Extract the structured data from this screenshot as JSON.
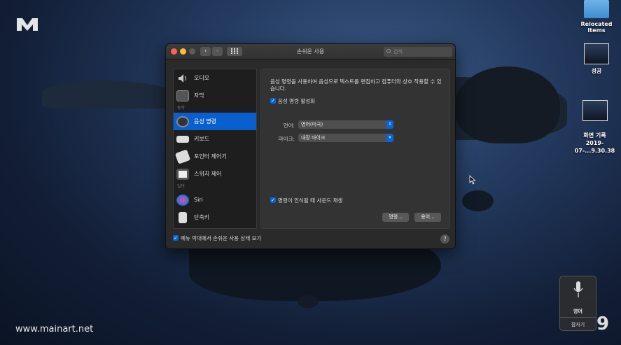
{
  "watermark": "www.mainart.net",
  "desktop_items": [
    {
      "label": "Relocated Items",
      "icon": "folder-icon"
    },
    {
      "label": "성공",
      "icon": "screenshot-thumb"
    },
    {
      "label": "화면 기록\n2019-07-...9.30.38",
      "icon": "screenshot-thumb"
    }
  ],
  "window": {
    "title": "손쉬운 사용",
    "search_placeholder": "검색",
    "nav_back": "‹",
    "nav_forward": "›",
    "sidebar": {
      "items_top": [
        {
          "label": "오디오",
          "icon": "speaker-icon"
        },
        {
          "label": "자막",
          "icon": "captions-icon"
        }
      ],
      "section_interaction": "동작",
      "items_mid": [
        {
          "label": "음성 명령",
          "icon": "voice-control-icon",
          "selected": true
        },
        {
          "label": "키보드",
          "icon": "keyboard-icon"
        },
        {
          "label": "포인터 제어기",
          "icon": "pointer-icon"
        },
        {
          "label": "스위치 제어",
          "icon": "switch-icon"
        }
      ],
      "section_general": "일반",
      "items_bottom": [
        {
          "label": "Siri",
          "icon": "siri-icon"
        },
        {
          "label": "단축키",
          "icon": "shortcut-icon"
        }
      ]
    },
    "pane": {
      "description": "음성 명령을 사용하여 음성으로 텍스트를 편집하고 컴퓨터와 상호 작용할 수 있습니다.",
      "enable_label": "음성 명령 활성화",
      "enable_checked": true,
      "language_label": "언어:",
      "language_value": "영어(미국)",
      "mic_label": "마이크:",
      "mic_value": "내장 마이크",
      "sound_label": "명령이 인식될 때 사운드 재생",
      "sound_checked": true,
      "commands_button": "명령...",
      "vocabulary_button": "용어..."
    },
    "footer_checkbox_label": "메뉴 막대에서 손쉬운 사용 상태 보기",
    "footer_checked": true,
    "help": "?"
  },
  "mic_panel": {
    "language": "영어",
    "collapse_label": "잠자기"
  },
  "overlay_number": "9",
  "colors": {
    "accent": "#0a5fcf",
    "window_bg": "#2a2a2a"
  }
}
